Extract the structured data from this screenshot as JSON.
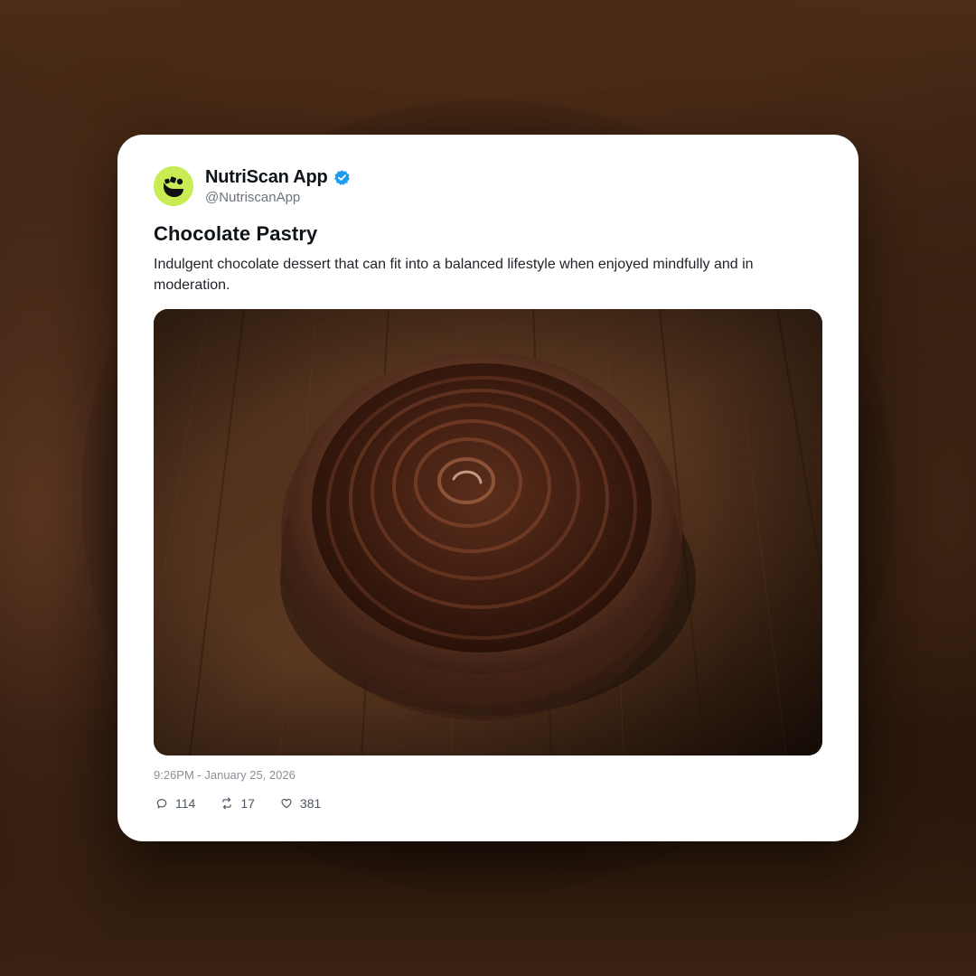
{
  "post": {
    "author": {
      "display_name": "NutriScan App",
      "handle": "@NutriscanApp",
      "verified": true,
      "avatar_color": "#c9ec55",
      "verified_color": "#1d9bf0"
    },
    "title": "Chocolate Pastry",
    "description": "Indulgent chocolate dessert that can fit into a balanced lifestyle when enjoyed mindfully and in moderation.",
    "image_alt_icon": "chocolate-tart-photo",
    "timestamp": "9:26PM - January 25, 2026",
    "stats": {
      "replies": "114",
      "reposts": "17",
      "likes": "381"
    }
  },
  "icons": {
    "reply": "comment-icon",
    "repost": "repost-icon",
    "like": "heart-icon",
    "verified": "verified-badge-icon"
  }
}
